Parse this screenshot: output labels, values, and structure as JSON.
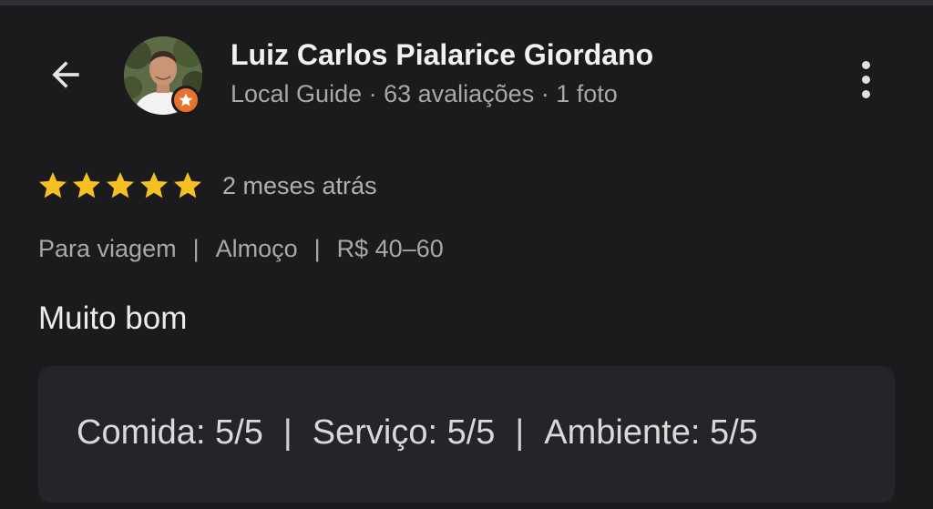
{
  "user": {
    "name": "Luiz Carlos Pialarice Giordano",
    "meta": "Local Guide · 63 avaliações · 1 foto"
  },
  "review": {
    "stars": 5,
    "time": "2 meses atrás",
    "tags": [
      "Para viagem",
      "Almoço",
      "R$ 40–60"
    ],
    "text": "Muito bom"
  },
  "scores": [
    {
      "label": "Comida: 5/5"
    },
    {
      "label": "Serviço: 5/5"
    },
    {
      "label": "Ambiente: 5/5"
    }
  ],
  "colors": {
    "background": "#1b1b1d",
    "star": "#f6c023",
    "badge": "#e8712d",
    "card": "#232528"
  },
  "icons": {
    "back": "arrow-left-icon",
    "more": "more-vert-icon",
    "badge": "local-guide-star-icon"
  }
}
